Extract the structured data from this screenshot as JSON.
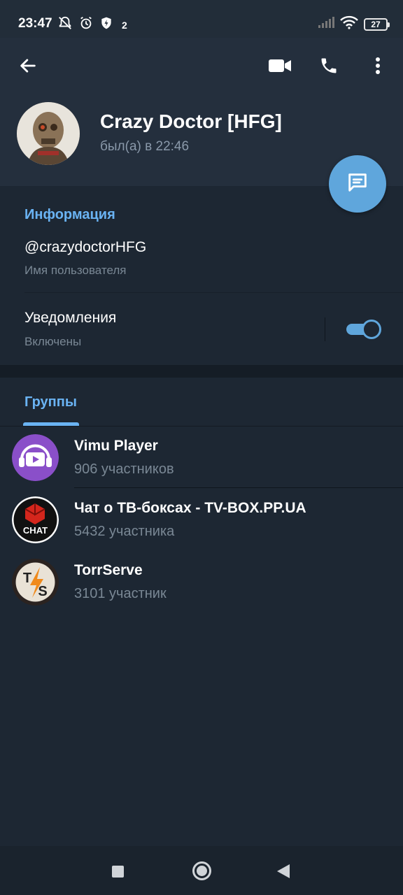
{
  "status_bar": {
    "time": "23:47",
    "notification_count": "2",
    "battery": "27",
    "icons_left": [
      "bell-muted-icon",
      "alarm-icon",
      "shield-icon"
    ],
    "icons_right": [
      "signal-icon",
      "wifi-icon",
      "battery-icon"
    ]
  },
  "header": {
    "actions": [
      "back-arrow-icon",
      "video-call-icon",
      "phone-icon",
      "more-vert-icon"
    ],
    "name": "Crazy Doctor [HFG]",
    "status": "был(а) в 22:46"
  },
  "info": {
    "title": "Информация",
    "username": "@crazydoctorHFG",
    "username_label": "Имя пользователя",
    "notifications_title": "Уведомления",
    "notifications_value": "Включены",
    "notifications_on": true
  },
  "groups": {
    "tab_label": "Группы",
    "items": [
      {
        "name": "Vimu Player",
        "count": "906 участников",
        "color": "#8a4fc9"
      },
      {
        "name": "Чат о ТВ-боксах - TV-BOX.PP.UA",
        "count": "5432 участника",
        "color": "#111111"
      },
      {
        "name": "TorrServe",
        "count": "3101 участник",
        "color": "#2b2320"
      }
    ]
  },
  "colors": {
    "accent": "#6ab3f3",
    "fab": "#5fa6dc",
    "background": "#1d2733",
    "header": "#242f3d"
  }
}
